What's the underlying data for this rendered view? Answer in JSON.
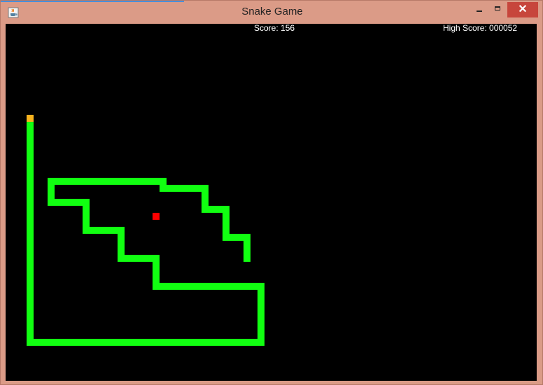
{
  "window": {
    "title": "Snake Game",
    "close_glyph": "✕",
    "app_icon": "java-cup-icon"
  },
  "hud": {
    "score": "Score: 156",
    "high_score": "High Score: 000052"
  },
  "colors": {
    "background": "#000000",
    "snake_body": "#11ff11",
    "snake_head": "#f7b21e",
    "food": "#ff0000",
    "titlebar": "#db9b87",
    "close_button": "#c7463c"
  }
}
